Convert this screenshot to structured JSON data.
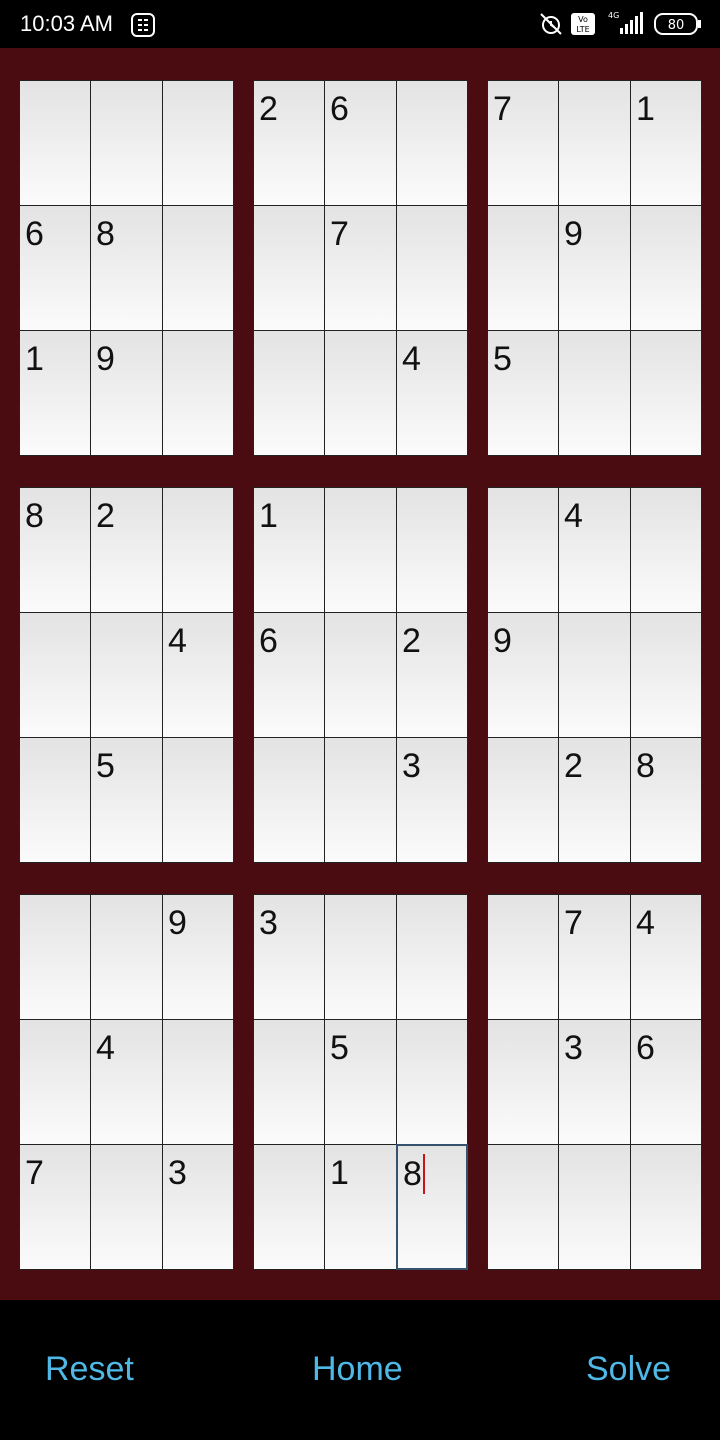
{
  "status_bar": {
    "time": "10:03 AM",
    "battery": "80",
    "network": "4G",
    "volte": "Vo LTE"
  },
  "board": {
    "rows": [
      [
        "",
        "",
        "",
        "2",
        "6",
        "",
        "7",
        "",
        "1"
      ],
      [
        "6",
        "8",
        "",
        "",
        "7",
        "",
        "",
        "9",
        ""
      ],
      [
        "1",
        "9",
        "",
        "",
        "",
        "4",
        "5",
        "",
        ""
      ],
      [
        "8",
        "2",
        "",
        "1",
        "",
        "",
        "",
        "4",
        ""
      ],
      [
        "",
        "",
        "4",
        "6",
        "",
        "2",
        "9",
        "",
        ""
      ],
      [
        "",
        "5",
        "",
        "",
        "",
        "3",
        "",
        "2",
        "8"
      ],
      [
        "",
        "",
        "9",
        "3",
        "",
        "",
        "",
        "7",
        "4"
      ],
      [
        "",
        "4",
        "",
        "",
        "5",
        "",
        "",
        "3",
        "6"
      ],
      [
        "7",
        "",
        "3",
        "",
        "1",
        "8",
        "",
        "",
        ""
      ]
    ],
    "active_cell": {
      "row": 8,
      "col": 5
    }
  },
  "nav": {
    "reset": "Reset",
    "home": "Home",
    "solve": "Solve"
  },
  "colors": {
    "board_bg": "#4a0c10",
    "button_text": "#4fb8e6",
    "caret": "#c51515"
  }
}
